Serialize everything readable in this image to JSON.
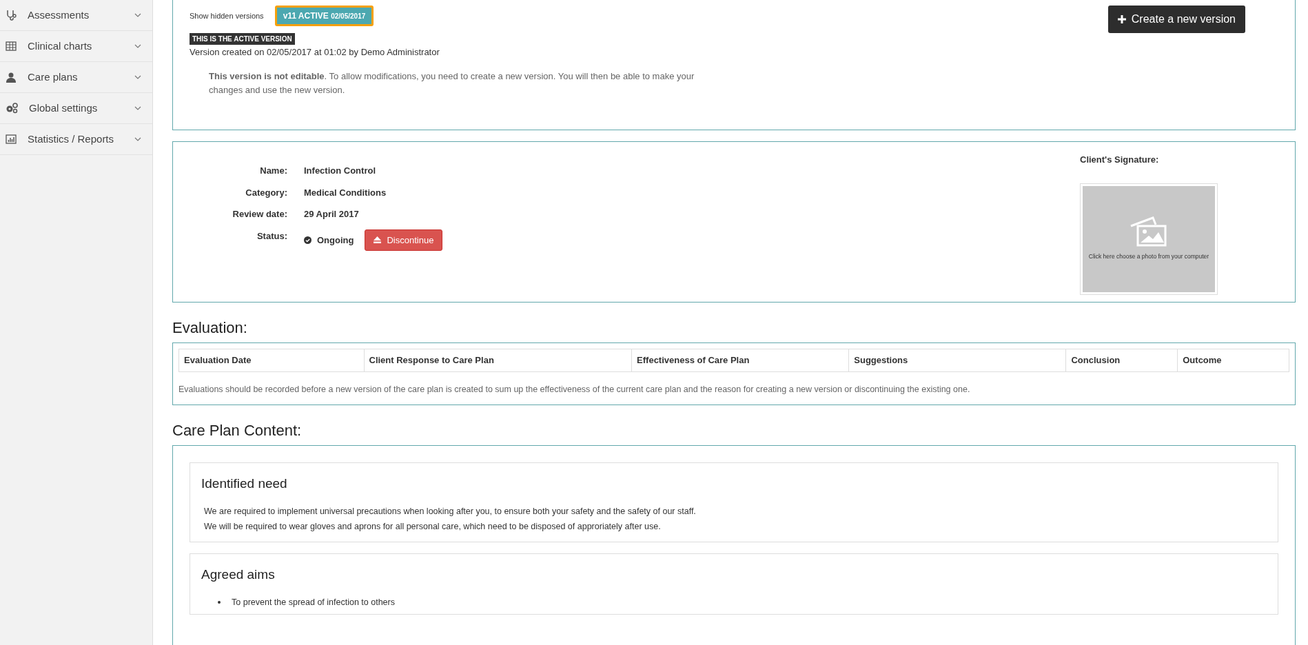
{
  "sidebar": {
    "items": [
      {
        "label": "Assessments"
      },
      {
        "label": "Clinical charts"
      },
      {
        "label": "Care plans"
      },
      {
        "label": "Global settings"
      },
      {
        "label": "Statistics / Reports"
      }
    ]
  },
  "versions": {
    "show_hidden_label": "Show hidden versions",
    "badge": {
      "label": "v11 ACTIVE",
      "date": "02/05/2017",
      "selected": true
    },
    "active_tag": "THIS IS THE ACTIVE VERSION",
    "created": "Version created on 02/05/2017 at 01:02 by Demo Administrator",
    "notice": "**This version is not editable**. To allow modifications, you need to create a new version. You will then be able to make your changes and use the new version.",
    "create_button": "Create a new version"
  },
  "details": {
    "fields": [
      {
        "label": "Name:",
        "value": "Infection Control"
      },
      {
        "label": "Category:",
        "value": "Medical Conditions"
      },
      {
        "label": "Review date:",
        "value": "29 April 2017"
      }
    ],
    "status": {
      "label": "Status:",
      "value": "Ongoing",
      "button": "Discontinue"
    },
    "signature": {
      "label": "Client's Signature:",
      "upload_hint": "Click here choose a photo from your computer"
    }
  },
  "evaluation": {
    "title": "Evaluation:",
    "columns": [
      "Evaluation Date",
      "Client Response to Care Plan",
      "Effectiveness of Care Plan",
      "Suggestions",
      "Conclusion",
      "Outcome"
    ],
    "note": "Evaluations should be recorded before a new version of the care plan is created to sum up the effectiveness of the current care plan and the reason for creating a new version or discontinuing the existing one."
  },
  "content": {
    "title": "Care Plan Content:",
    "sections": [
      {
        "title": "Identified need",
        "kind": "paragraphs",
        "lines": [
          "We are required to implement universal precautions when looking after you, to ensure both your safety and the safety of our staff.",
          "We will be required to wear gloves and aprons for all personal care, which need to be disposed of approriately after use."
        ]
      },
      {
        "title": "Agreed aims",
        "kind": "bullets",
        "lines": [
          "To prevent the spread of infection to others"
        ]
      }
    ]
  }
}
